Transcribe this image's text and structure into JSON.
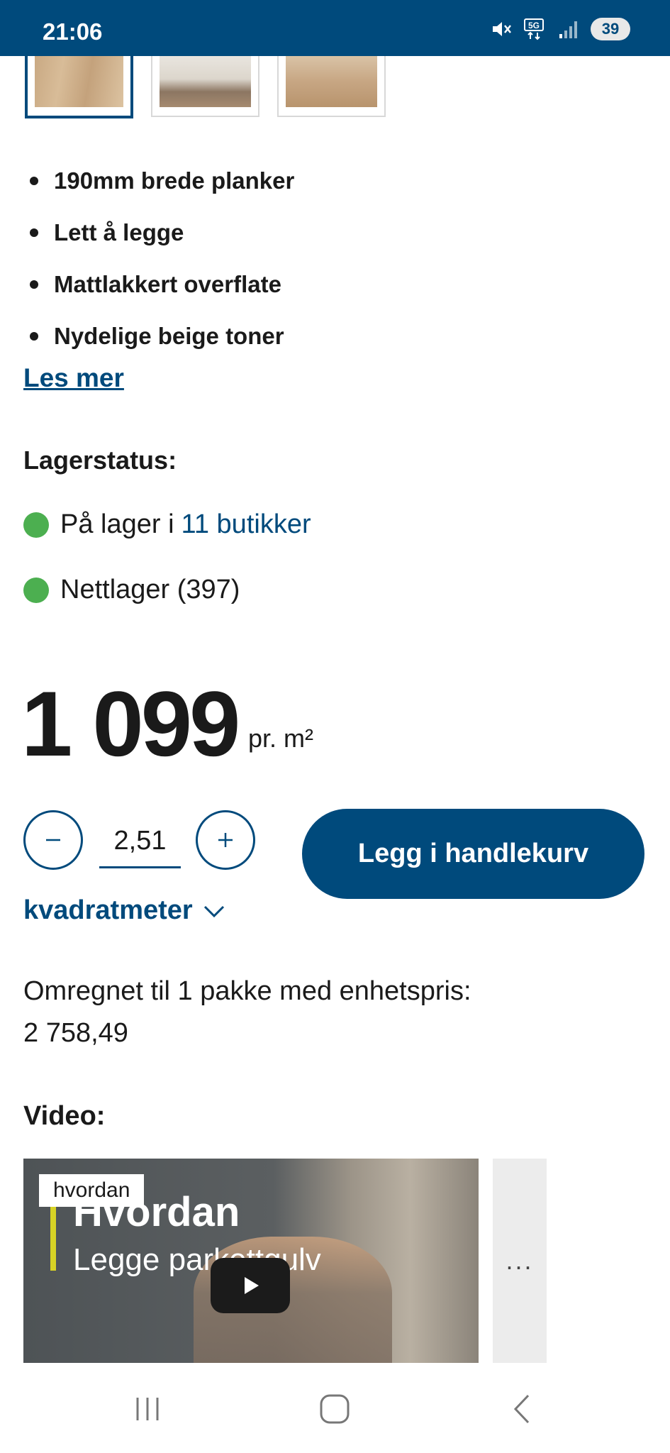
{
  "status_bar": {
    "time": "21:06",
    "battery": "39",
    "network": "5G"
  },
  "thumbnails": [
    {
      "name": "thumb-oak-plank",
      "active": true
    },
    {
      "name": "thumb-living-room",
      "active": false
    },
    {
      "name": "thumb-floor",
      "active": false
    }
  ],
  "features": [
    "190mm brede planker",
    "Lett å legge",
    "Mattlakkert overflate",
    "Nydelige beige toner"
  ],
  "read_more": "Les mer",
  "stock": {
    "title": "Lagerstatus:",
    "store_prefix": "På lager i",
    "store_link": "11 butikker",
    "online": "Nettlager (397)",
    "status_color": "#4caf50"
  },
  "price": {
    "amount": "1 099",
    "unit": "pr. m²"
  },
  "quantity": {
    "value": "2,51",
    "unit": "kvadratmeter"
  },
  "add_to_cart": "Legg i handlekurv",
  "converted": {
    "label": "Omregnet til 1 pakke med enhetspris:",
    "value": "2 758,49"
  },
  "video": {
    "section_title": "Video:",
    "tag": "hvordan",
    "title": "Hvordan",
    "subtitle": "Legge parkettgulv",
    "more": "..."
  },
  "colors": {
    "brand": "#004a7c",
    "in_stock": "#4caf50"
  }
}
